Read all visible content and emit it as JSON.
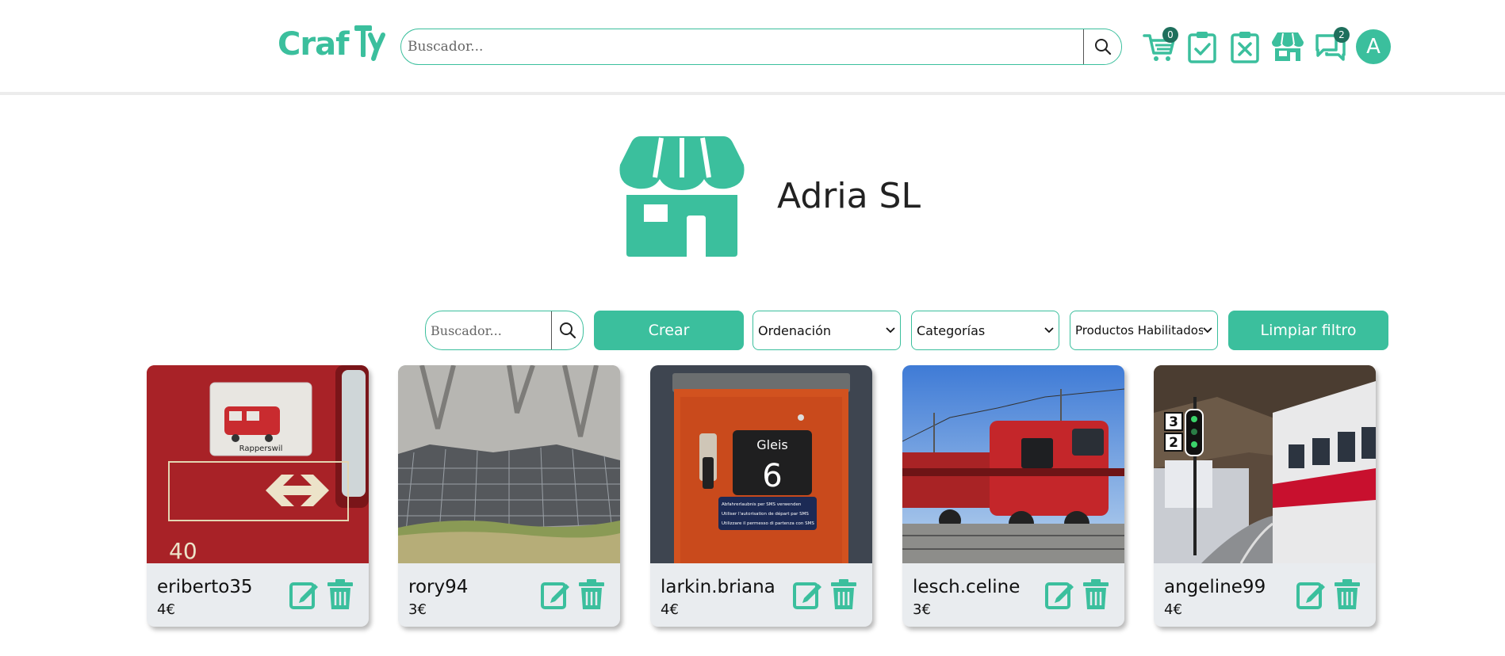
{
  "header": {
    "logo_text": "Craf",
    "search_placeholder": "Buscador...",
    "cart_count": "0",
    "messages_count": "2",
    "avatar_letter": "A",
    "icons": [
      "cart-icon",
      "orders-accepted-icon",
      "orders-rejected-icon",
      "store-icon",
      "chat-icon"
    ]
  },
  "shop": {
    "name": "Adria SL"
  },
  "toolbar": {
    "search_placeholder": "Buscador...",
    "create_label": "Crear",
    "sort_label": "Ordenación",
    "category_label": "Categorías",
    "products_filter_label": "Productos Habilitados",
    "clear_label": "Limpiar filtro"
  },
  "products": [
    {
      "name": "eriberto35",
      "price": "4€"
    },
    {
      "name": "rory94",
      "price": "3€"
    },
    {
      "name": "larkin.briana",
      "price": "4€"
    },
    {
      "name": "lesch.celine",
      "price": "3€"
    },
    {
      "name": "angeline99",
      "price": "4€"
    }
  ],
  "card_images": [
    {
      "sign": "Rapperswil",
      "number": "40"
    },
    {},
    {
      "title": "Gleis",
      "number": "6",
      "lines": [
        "Abfahrerlaubnis per SMS verwenden",
        "Utiliser l'autorisation de départ par SMS",
        "Utilizzare il permesso di partenza con SMS"
      ]
    },
    {},
    {
      "signal_top": "3",
      "signal_bottom": "2"
    }
  ],
  "colors": {
    "accent": "#3bbf9d",
    "badge": "#1e6f5c",
    "card_bg": "#e9ecef"
  }
}
